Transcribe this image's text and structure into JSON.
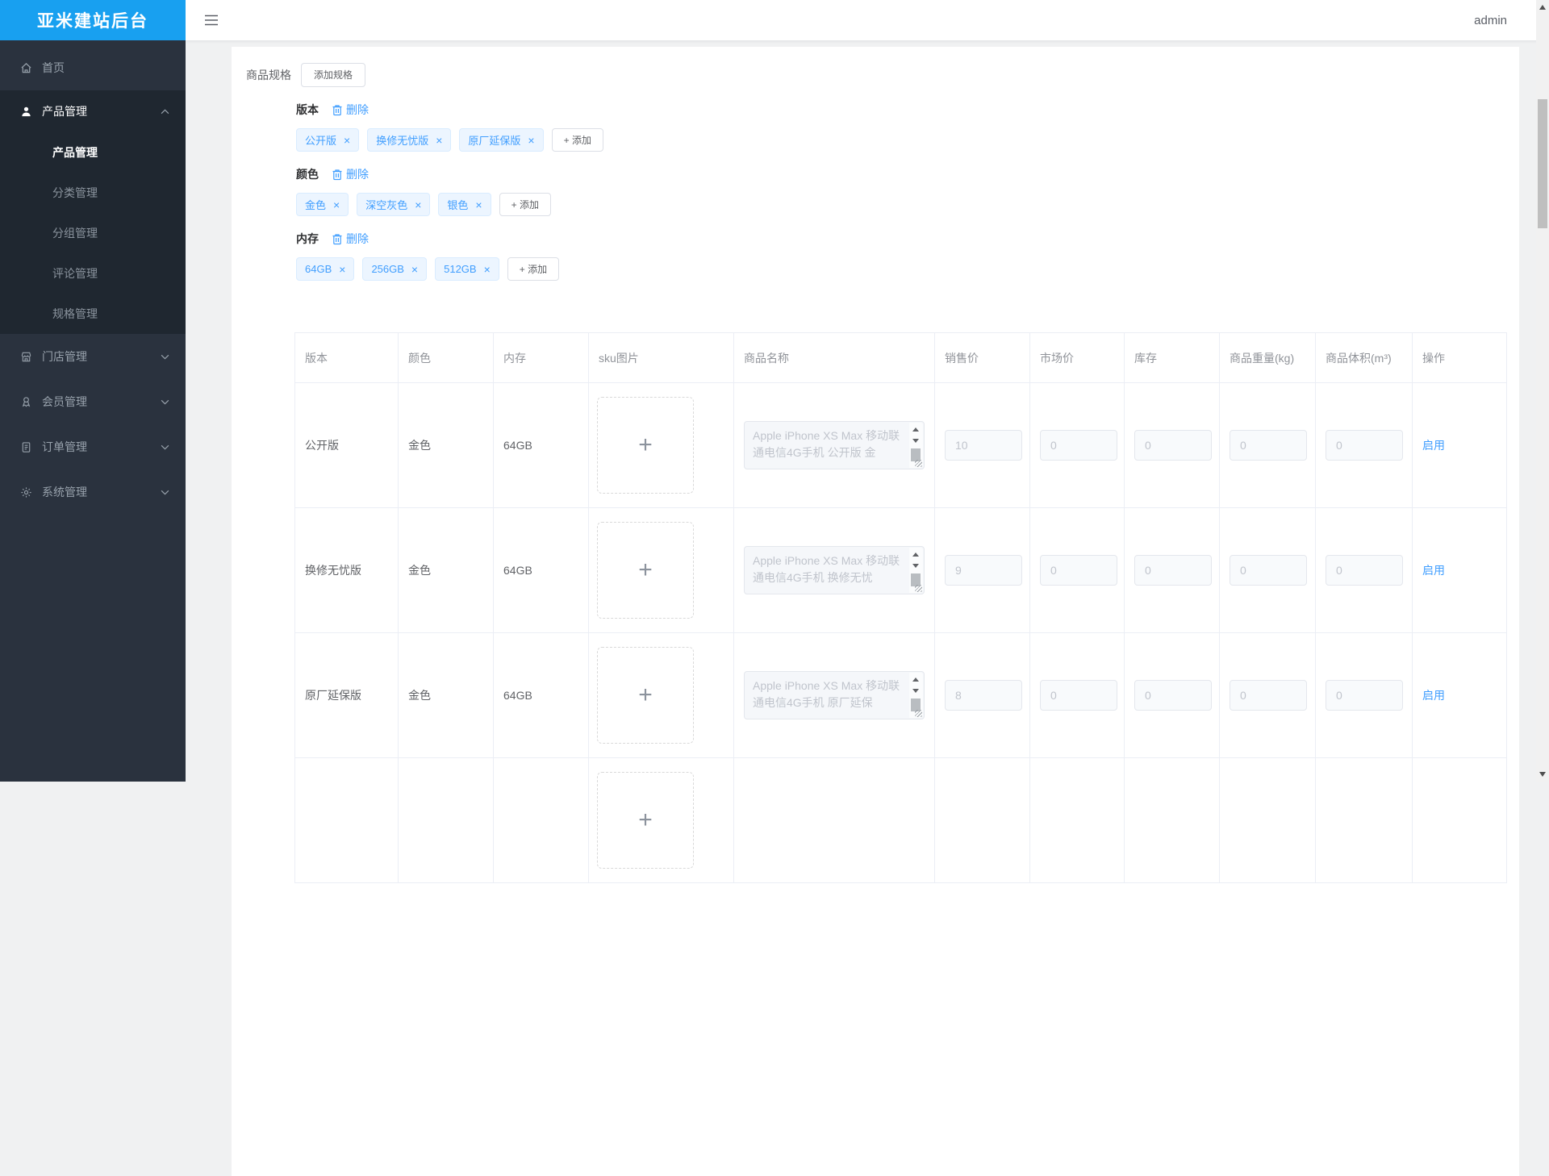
{
  "app": {
    "title": "亚米建站后台",
    "user": "admin"
  },
  "sidebar": {
    "home": "首页",
    "product_group": "产品管理",
    "product_children": [
      "产品管理",
      "分类管理",
      "分组管理",
      "评论管理",
      "规格管理"
    ],
    "store": "门店管理",
    "member": "会员管理",
    "order": "订单管理",
    "system": "系统管理"
  },
  "toolbar": {
    "spec_label": "商品规格",
    "add_spec": "添加规格"
  },
  "specs": {
    "delete_label": "删除",
    "add_label": "+ 添加",
    "groups": [
      {
        "name": "版本",
        "tags": [
          "公开版",
          "换修无忧版",
          "原厂延保版"
        ]
      },
      {
        "name": "颜色",
        "tags": [
          "金色",
          "深空灰色",
          "银色"
        ]
      },
      {
        "name": "内存",
        "tags": [
          "64GB",
          "256GB",
          "512GB"
        ]
      }
    ]
  },
  "table": {
    "headers": [
      "版本",
      "颜色",
      "内存",
      "sku图片",
      "商品名称",
      "销售价",
      "市场价",
      "库存",
      "商品重量(kg)",
      "商品体积(m³)",
      "操作"
    ],
    "rows": [
      {
        "version": "公开版",
        "color": "金色",
        "memory": "64GB",
        "name": "Apple iPhone XS Max 移动联通电信4G手机 公开版 金",
        "price": "10",
        "market_price": "0",
        "stock": "0",
        "weight": "0",
        "volume": "0",
        "action": "启用"
      },
      {
        "version": "换修无忧版",
        "color": "金色",
        "memory": "64GB",
        "name": "Apple iPhone XS Max 移动联通电信4G手机 换修无忧",
        "price": "9",
        "market_price": "0",
        "stock": "0",
        "weight": "0",
        "volume": "0",
        "action": "启用"
      },
      {
        "version": "原厂延保版",
        "color": "金色",
        "memory": "64GB",
        "name": "Apple iPhone XS Max 移动联通电信4G手机 原厂延保",
        "price": "8",
        "market_price": "0",
        "stock": "0",
        "weight": "0",
        "volume": "0",
        "action": "启用"
      }
    ]
  },
  "icons": {
    "close": "×",
    "plus": "+"
  },
  "colors": {
    "accent": "#409eff",
    "logo_bg": "#18a0f0",
    "sidebar_bg": "#2a323e",
    "submenu_bg": "#1f2730",
    "tag_bg": "#ecf5ff"
  }
}
